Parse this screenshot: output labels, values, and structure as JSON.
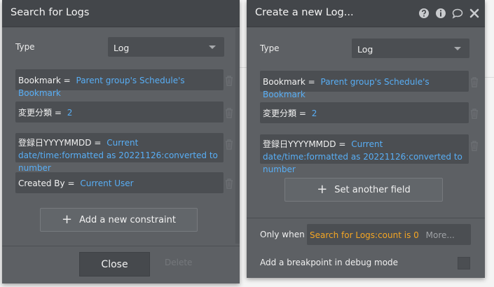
{
  "left_panel": {
    "title": "Search for Logs",
    "type_label": "Type",
    "type_value": "Log",
    "constraints": [
      {
        "key": "Bookmark =",
        "value": "Parent group's Schedule's Bookmark"
      },
      {
        "key": "変更分類 =",
        "value": "2"
      },
      {
        "key": "登録日YYYYMMDD =",
        "value": "Current date/time:formatted as 20221126:converted to number"
      },
      {
        "key": "Created By =",
        "value": "Current User"
      }
    ],
    "add_constraint_label": "Add a new constraint",
    "close_label": "Close",
    "delete_label": "Delete"
  },
  "right_panel": {
    "title": "Create a new Log...",
    "header_icons": [
      "help-icon",
      "info-icon",
      "comment-icon",
      "close-icon"
    ],
    "type_label": "Type",
    "type_value": "Log",
    "fields": [
      {
        "key": "Bookmark =",
        "value": "Parent group's Schedule's Bookmark"
      },
      {
        "key": "変更分類 =",
        "value": "2"
      },
      {
        "key": "登録日YYYYMMDD =",
        "value": "Current date/time:formatted as 20221126:converted to number"
      }
    ],
    "set_field_label": "Set another field",
    "only_when_label": "Only when",
    "only_when_value": "Search for Logs:count is 0",
    "only_when_more": "More...",
    "breakpoint_label": "Add a breakpoint in debug mode"
  }
}
